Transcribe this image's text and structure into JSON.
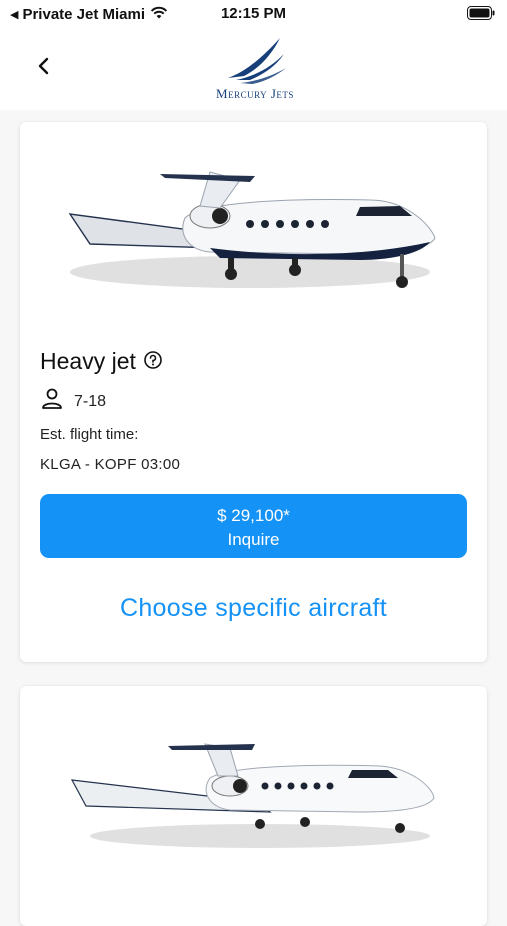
{
  "status_bar": {
    "back_app": "Private Jet Miami",
    "time": "12:15 PM"
  },
  "header": {
    "logo_text": "Mercury Jets",
    "brand_color": "#17407a"
  },
  "card": {
    "category": "Heavy jet",
    "passengers": "7-18",
    "flight_time_label": "Est. flight time:",
    "route": "KLGA - KOPF 03:00",
    "price": "$ 29,100*",
    "inquire_label": "Inquire",
    "choose_label": "Choose specific aircraft",
    "accent_color": "#1592f5"
  },
  "icons": [
    "back-chevron-icon",
    "wifi-icon",
    "battery-icon",
    "help-icon",
    "person-icon"
  ]
}
